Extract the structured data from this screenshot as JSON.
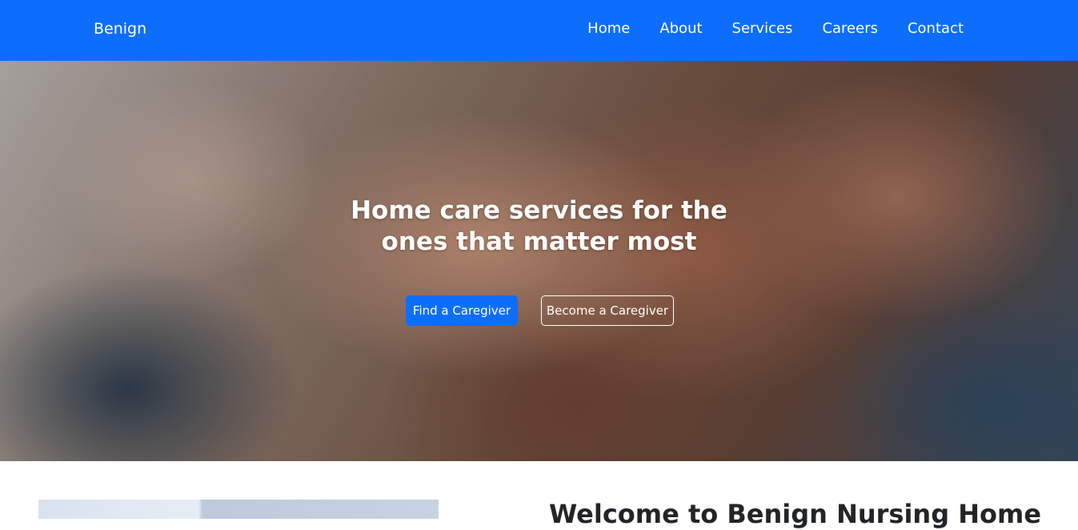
{
  "navbar": {
    "brand": "Benign",
    "links": [
      "Home",
      "About",
      "Services",
      "Careers",
      "Contact"
    ],
    "background_color": "#0d6efd"
  },
  "hero": {
    "title": "Home care services for the\nones that matter most",
    "primary_button": "Find a Caregiver",
    "secondary_button": "Become a Caregiver"
  },
  "about": {
    "title": "Welcome to Benign Nursing Home"
  }
}
